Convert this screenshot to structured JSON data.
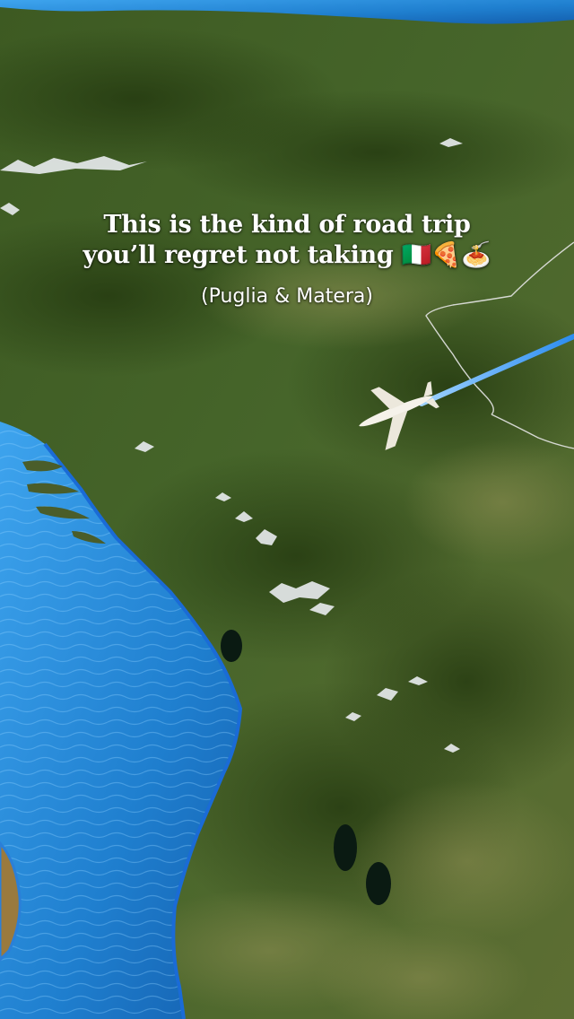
{
  "caption": {
    "line1": "This is the kind of road trip",
    "line2": "you’ll regret not taking 🇮🇹🍕🍝",
    "subtitle": "(Puglia & Matera)"
  },
  "map": {
    "flight_path_icon": "airplane-icon",
    "colors": {
      "sea": "#1f7fcf",
      "sea_light": "#3ea4ee",
      "land_dark": "#2f4a1c",
      "land_mid": "#4d6a2c",
      "land_light": "#7e8a4a",
      "flight_path": "#2b8cf0",
      "border": "#e6e6e6"
    }
  }
}
